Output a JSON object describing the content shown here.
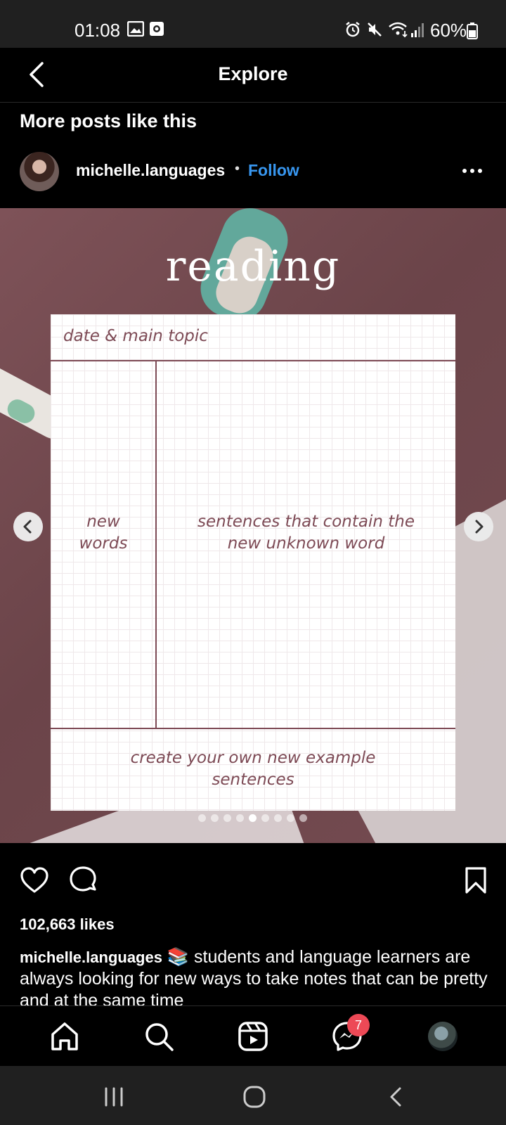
{
  "status_bar": {
    "time": "01:08",
    "battery": "60%"
  },
  "nav": {
    "title": "Explore"
  },
  "section_title": "More posts like this",
  "post": {
    "username": "michelle.languages",
    "separator": "•",
    "follow_label": "Follow",
    "image": {
      "title": "reading",
      "cells": {
        "header": "date & main topic",
        "left": "new\nwords",
        "right": "sentences that contain the\nnew unknown word",
        "footer": "create your own new example\nsentences"
      },
      "carousel": {
        "count": 9,
        "active_index": 4
      }
    },
    "likes": "102,663 likes",
    "caption_user": "michelle.languages",
    "caption_text": "📚 students and language learners are always looking for new ways to take notes that can be pretty and at the same time"
  },
  "bottom_nav": {
    "messages_badge": "7"
  },
  "colors": {
    "accent": "#3897f0",
    "badge": "#ed4956",
    "template_ink": "#7d4a55"
  }
}
